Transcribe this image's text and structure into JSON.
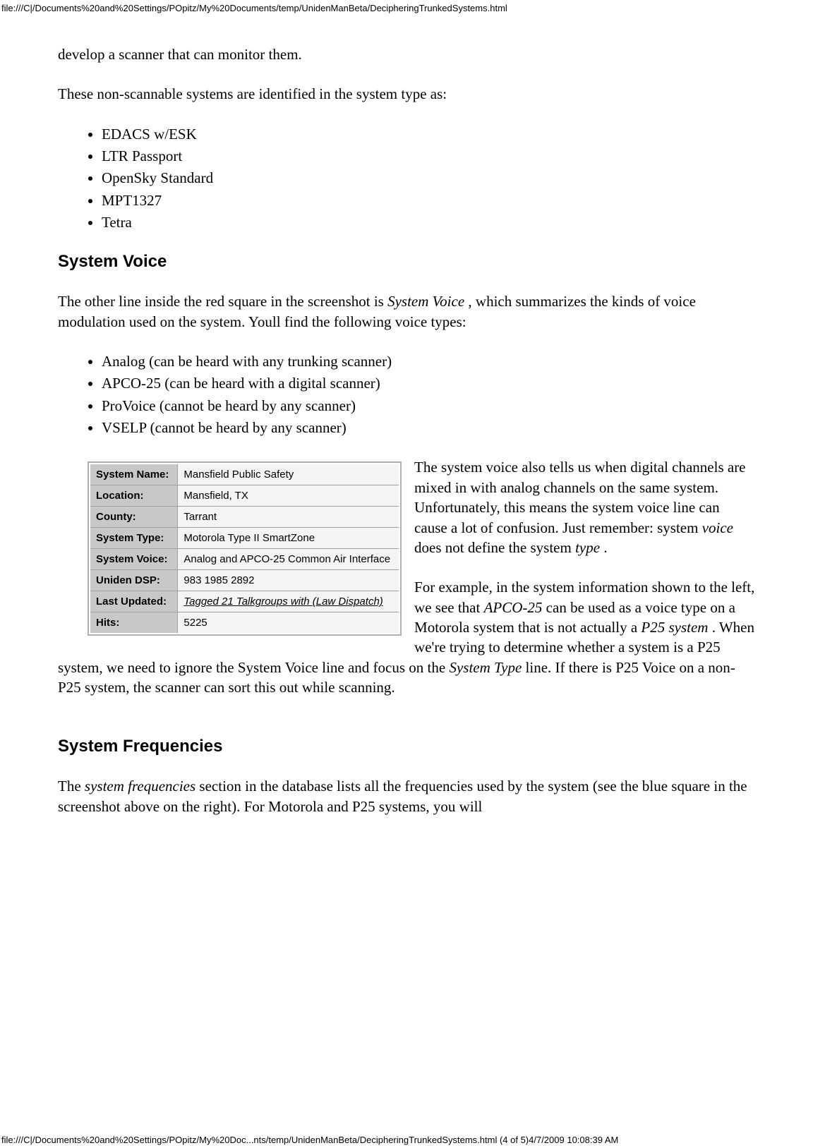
{
  "url_header": "file:///C|/Documents%20and%20Settings/POpitz/My%20Documents/temp/UnidenManBeta/DecipheringTrunkedSystems.html",
  "para_intro": "develop a scanner that can monitor them.",
  "para_nonscannable": "These non-scannable systems are identified in the system type as:",
  "nonscannable_items": [
    "EDACS w/ESK",
    "LTR Passport",
    "OpenSky Standard",
    "MPT1327",
    "Tetra"
  ],
  "heading_voice": "System Voice",
  "voice_para1_a": "The other line inside the red square in the screenshot is ",
  "voice_para1_em": "System Voice ",
  "voice_para1_b": ", which summarizes the kinds of voice modulation used on the system. Youll find the following voice types:",
  "voice_items": [
    "Analog (can be heard with any trunking scanner)",
    "APCO-25 (can be heard with a digital scanner)",
    "ProVoice (cannot be heard by any scanner)",
    "VSELP (cannot be heard by any scanner)"
  ],
  "info_table": {
    "rows": [
      {
        "label": "System Name:",
        "value": "Mansfield Public Safety"
      },
      {
        "label": "Location:",
        "value": "Mansfield, TX"
      },
      {
        "label": "County:",
        "value": "Tarrant"
      },
      {
        "label": "System Type:",
        "value": "Motorola Type II SmartZone"
      },
      {
        "label": "System Voice:",
        "value": "Analog and APCO-25 Common Air Interface"
      },
      {
        "label": "Uniden DSP:",
        "value": "983 1985 2892"
      },
      {
        "label": "Last Updated:",
        "value": "Tagged 21 Talkgroups with (Law Dispatch)",
        "link": true
      },
      {
        "label": "Hits:",
        "value": "5225"
      }
    ]
  },
  "wrap_para1_a": "The system voice also tells us when digital channels are mixed in with analog channels on the same system. Unfortunately, this means the system voice line can cause a lot of confusion. Just remember: system ",
  "wrap_para1_em1": "voice",
  "wrap_para1_b": " does not define the system ",
  "wrap_para1_em2": "type ",
  "wrap_para1_c": ".",
  "wrap_para2_a": "For example, in the system information shown to the left, we see that ",
  "wrap_para2_em1": "APCO-25",
  "wrap_para2_b": " can be used as a voice type on a Motorola system that is not actually a ",
  "wrap_para2_em2": "P25 system ",
  "wrap_para2_c": ". When we're trying to determine whether a system is a P25 system, we need to ignore the System Voice line and focus on the ",
  "wrap_para2_em3": "System Type",
  "wrap_para2_d": " line. If there is P25 Voice on a non-P25 system, the scanner can sort this out while scanning.",
  "heading_freq": "System Frequencies",
  "freq_para_a": "The ",
  "freq_para_em": "system frequencies",
  "freq_para_b": " section in the database lists all the frequencies used by the system (see the blue square in the screenshot above on the right). For Motorola and P25 systems, you will",
  "footer_left": "file:///C|/Documents%20and%20Settings/POpitz/My%20Doc...nts/temp/UnidenManBeta/DecipheringTrunkedSystems.html (4 of 5)4/7/2009 10:08:39 AM"
}
